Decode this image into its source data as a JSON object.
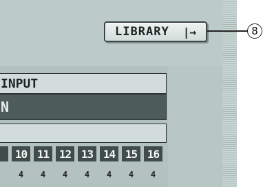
{
  "library_button": {
    "label": "LIBRARY",
    "arrow": "|→"
  },
  "callout": {
    "number": "8"
  },
  "panel": {
    "input_label": "INPUT",
    "on_label": "N"
  },
  "channels": [
    "",
    "10",
    "11",
    "12",
    "13",
    "14",
    "15",
    "16"
  ],
  "values": [
    "",
    "4",
    "4",
    "4",
    "4",
    "4",
    "4",
    "4"
  ]
}
